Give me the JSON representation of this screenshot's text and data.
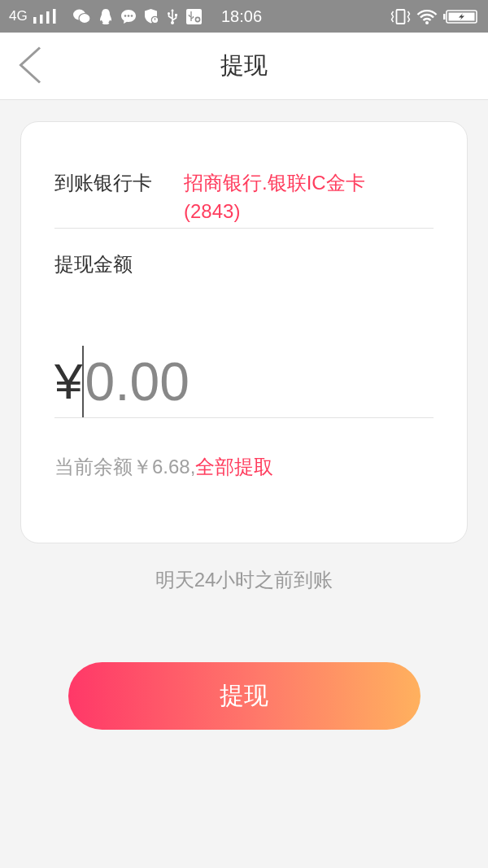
{
  "status_bar": {
    "network": "4G",
    "time": "18:06"
  },
  "nav_bar": {
    "title": "提现"
  },
  "card": {
    "bank_row": {
      "label": "到账银行卡",
      "value": "招商银行.银联IC金卡(2843)"
    },
    "amount": {
      "label": "提现金额",
      "currency": "¥",
      "placeholder": "0.00",
      "focused": true
    },
    "balance": {
      "text": "当前余额￥6.68,",
      "link": "全部提取"
    }
  },
  "arrival_note": "明天24小时之前到账",
  "submit_button": {
    "label": "提现"
  }
}
